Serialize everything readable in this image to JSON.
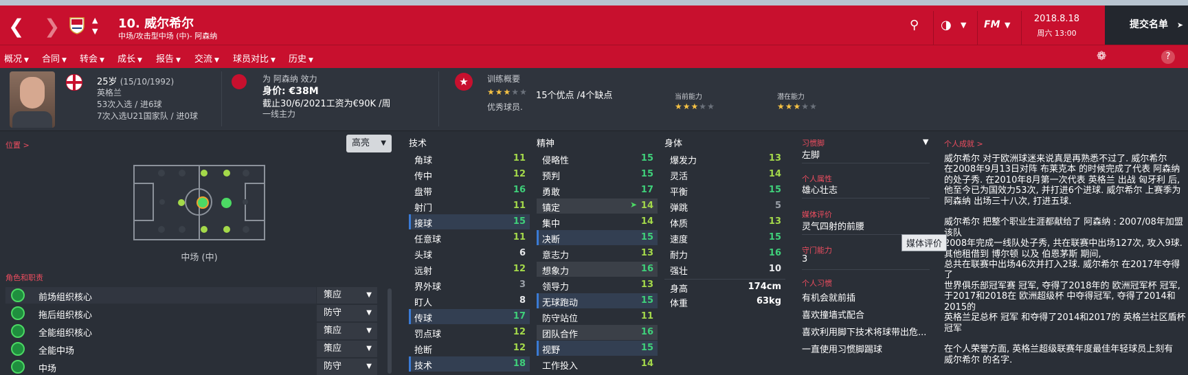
{
  "header": {
    "player_title": "10. 威尔希尔",
    "player_subtitle": "中场/攻击型中场 (中)- 阿森纳",
    "date": "2018.8.18",
    "weekday_time": "周六 13:00",
    "submit_label": "提交名单",
    "fm_label": "FM"
  },
  "tabs": [
    {
      "label": "概况"
    },
    {
      "label": "合同"
    },
    {
      "label": "转会"
    },
    {
      "label": "成长"
    },
    {
      "label": "报告"
    },
    {
      "label": "交流"
    },
    {
      "label": "球员对比"
    },
    {
      "label": "历史"
    }
  ],
  "info": {
    "age": "25岁",
    "dob": "(15/10/1992)",
    "nationality": "英格兰",
    "caps": "53次入选 / 进6球",
    "u21_caps": "7次入选U21国家队 / 进0球",
    "plays_for": "为 阿森纳 效力",
    "value": "身价: €38M",
    "contract": "截止30/6/2021工资为€90K /周",
    "squad_status": "一线主力",
    "training_title": "训练概要",
    "training_summary": "15个优点 /4个缺点",
    "training_note": "优秀球员.",
    "current_ability_label": "当前能力",
    "potential_ability_label": "潜在能力",
    "training_stars": 3,
    "current_stars": 3,
    "potential_stars": 3
  },
  "left": {
    "position_title": "位置 >",
    "highlight_label": "高亮",
    "position_caption": "中场 (中)",
    "roles_title": "角色和职责",
    "roles": [
      {
        "name": "前场组织核心",
        "duty": "策应"
      },
      {
        "name": "拖后组织核心",
        "duty": "防守"
      },
      {
        "name": "全能组织核心",
        "duty": "策应"
      },
      {
        "name": "全能中场",
        "duty": "策应"
      },
      {
        "name": "中场",
        "duty": "防守"
      }
    ]
  },
  "attributes": {
    "technical_title": "技术",
    "mental_title": "精神",
    "physical_title": "身体",
    "technical": [
      {
        "name": "角球",
        "value": "11"
      },
      {
        "name": "传中",
        "value": "12"
      },
      {
        "name": "盘带",
        "value": "16"
      },
      {
        "name": "射门",
        "value": "11"
      },
      {
        "name": "接球",
        "value": "15"
      },
      {
        "name": "任意球",
        "value": "11"
      },
      {
        "name": "头球",
        "value": "6"
      },
      {
        "name": "远射",
        "value": "12"
      },
      {
        "name": "界外球",
        "value": "3"
      },
      {
        "name": "盯人",
        "value": "8"
      },
      {
        "name": "传球",
        "value": "17"
      },
      {
        "name": "罚点球",
        "value": "12"
      },
      {
        "name": "抢断",
        "value": "12"
      },
      {
        "name": "技术",
        "value": "18"
      }
    ],
    "mental": [
      {
        "name": "侵略性",
        "value": "15"
      },
      {
        "name": "预判",
        "value": "15"
      },
      {
        "name": "勇敢",
        "value": "17"
      },
      {
        "name": "镇定",
        "value": "14"
      },
      {
        "name": "集中",
        "value": "14"
      },
      {
        "name": "决断",
        "value": "15"
      },
      {
        "name": "意志力",
        "value": "13"
      },
      {
        "name": "想象力",
        "value": "16"
      },
      {
        "name": "领导力",
        "value": "13"
      },
      {
        "name": "无球跑动",
        "value": "15"
      },
      {
        "name": "防守站位",
        "value": "11"
      },
      {
        "name": "团队合作",
        "value": "16"
      },
      {
        "name": "视野",
        "value": "15"
      },
      {
        "name": "工作投入",
        "value": "14"
      }
    ],
    "physical": [
      {
        "name": "爆发力",
        "value": "13"
      },
      {
        "name": "灵活",
        "value": "14"
      },
      {
        "name": "平衡",
        "value": "15"
      },
      {
        "name": "弹跳",
        "value": "5"
      },
      {
        "name": "体质",
        "value": "13"
      },
      {
        "name": "速度",
        "value": "15"
      },
      {
        "name": "耐力",
        "value": "16"
      },
      {
        "name": "强壮",
        "value": "10"
      }
    ],
    "height_label": "身高",
    "height_value": "174cm",
    "weight_label": "体重",
    "weight_value": "63kg"
  },
  "side": {
    "foot_label": "习惯脚",
    "foot_value": "左脚",
    "personality_label": "个人属性",
    "personality_value": "雄心壮志",
    "media_label": "媒体评价",
    "media_value": "灵气四射的前腰",
    "gk_label": "守门能力",
    "gk_value": "3",
    "habits_label": "个人习惯",
    "habits": [
      "有机会就前插",
      "喜欢撞墙式配合",
      "喜欢利用脚下技术将球带出危...",
      "一直使用习惯脚踢球"
    ]
  },
  "bio": {
    "title": "个人成就 >",
    "text": "威尔希尔 对于欧洲球迷来说真是再熟悉不过了. 威尔希尔\n在2008年9月13日对阵 布莱克本 的时候完成了代表 阿森纳\n的处子秀. 在2010年8月第一次代表 英格兰 出战 匈牙利 后,\n他至今已为国效力53次, 并打进6个进球. 威尔希尔 上赛季为\n阿森纳 出场三十八次, 打进五球.\n\n威尔希尔 把整个职业生涯都献给了 阿森纳 : 2007/08年加盟该队\n2008年完成一线队处子秀, 共在联赛中出场127次, 攻入9球.\n其他租借到 博尔顿 以及 伯恩茅斯 期间,\n总共在联赛中出场46次并打入2球. 威尔希尔 在2017年夺得了\n世界俱乐部冠军赛 冠军, 夺得了2018年的 欧洲冠军杯 冠军,\n于2017和2018在 欧洲超级杯 中夺得冠军, 夺得了2014和2015的\n英格兰足总杯 冠军 和夺得了2014和2017的 英格兰社区盾杯 冠军\n\n在个人荣誉方面, 英格兰超级联赛年度最佳年轻球员上刻有\n威尔希尔 的名字.",
    "tooltip": "媒体评价"
  },
  "colors": {
    "header_red": "#c8102e",
    "panel_bg": "#2a2f37",
    "accent_label": "#ee4d5f",
    "attr_green": "#3fd07a",
    "star": "#f6c244"
  }
}
